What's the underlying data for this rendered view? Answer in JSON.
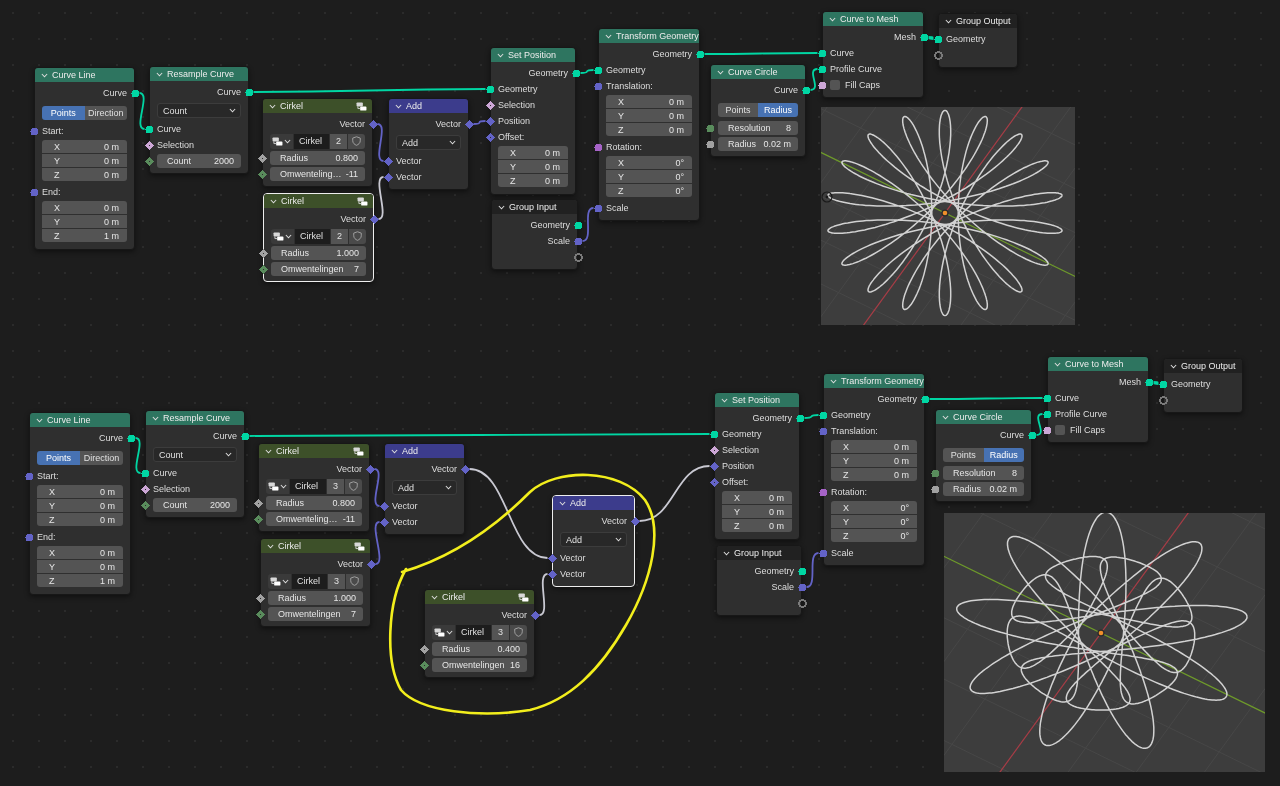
{
  "graphs": [
    {
      "nodes": [
        {
          "title": "Curve Line",
          "kind": "node",
          "color": "#2e7560",
          "selected": false,
          "rows": [
            {
              "kind": "output",
              "label": "Curve",
              "socket": {
                "kind": "circle",
                "color": "#00d6a3"
              }
            },
            {
              "kind": "toggle",
              "options": [
                {
                  "label": "Points",
                  "selected": true
                },
                {
                  "label": "Direction",
                  "selected": false
                }
              ]
            },
            {
              "kind": "input",
              "label": "Start:",
              "socket": {
                "kind": "circle",
                "color": "#6363c7"
              }
            },
            {
              "kind": "vector",
              "fields": [
                {
                  "axis": "X",
                  "value": "0 m"
                },
                {
                  "axis": "Y",
                  "value": "0 m"
                },
                {
                  "axis": "Z",
                  "value": "0 m"
                }
              ]
            },
            {
              "kind": "input",
              "label": "End:",
              "socket": {
                "kind": "circle",
                "color": "#6363c7"
              }
            },
            {
              "kind": "vector",
              "fields": [
                {
                  "axis": "X",
                  "value": "0 m"
                },
                {
                  "axis": "Y",
                  "value": "0 m"
                },
                {
                  "axis": "Z",
                  "value": "1 m"
                }
              ]
            }
          ]
        },
        {
          "title": "Resample Curve",
          "kind": "node",
          "color": "#2e7560",
          "selected": false,
          "rows": [
            {
              "kind": "output",
              "label": "Curve",
              "socket": {
                "kind": "circle",
                "color": "#00d6a3"
              }
            },
            {
              "kind": "dropdown",
              "value": "Count"
            },
            {
              "kind": "input",
              "label": "Curve",
              "socket": {
                "kind": "circle",
                "color": "#00d6a3"
              }
            },
            {
              "kind": "input",
              "label": "Selection",
              "socket": {
                "kind": "dotted",
                "color": "#cca6d6"
              }
            },
            {
              "kind": "field",
              "label": "Count",
              "value": "2000",
              "socket": {
                "kind": "dotted",
                "color": "#598c5c"
              }
            }
          ]
        },
        {
          "title": "Cirkel",
          "kind": "group",
          "color": "#3d5029",
          "selected": false,
          "rows": [
            {
              "kind": "output",
              "label": "Vector",
              "socket": {
                "kind": "diamond",
                "color": "#6363c7"
              }
            },
            {
              "kind": "datablock",
              "name": "Cirkel",
              "users": "2"
            },
            {
              "kind": "field",
              "label": "Radius",
              "value": "0.800",
              "socket": {
                "kind": "dotted",
                "color": "#a1a1a1"
              }
            },
            {
              "kind": "field",
              "label": "Omwenteling…",
              "value": "-11",
              "socket": {
                "kind": "dotted",
                "color": "#598c5c"
              }
            }
          ]
        },
        {
          "title": "Cirkel",
          "kind": "group",
          "color": "#3d5029",
          "selected": true,
          "rows": [
            {
              "kind": "output",
              "label": "Vector",
              "socket": {
                "kind": "diamond",
                "color": "#6363c7"
              }
            },
            {
              "kind": "datablock",
              "name": "Cirkel",
              "users": "2"
            },
            {
              "kind": "field",
              "label": "Radius",
              "value": "1.000",
              "socket": {
                "kind": "dotted",
                "color": "#a1a1a1"
              }
            },
            {
              "kind": "field",
              "label": "Omwentelingen",
              "value": "7",
              "socket": {
                "kind": "dotted",
                "color": "#598c5c"
              }
            }
          ]
        },
        {
          "title": "Add",
          "kind": "node",
          "color": "#3c3c8c",
          "selected": false,
          "rows": [
            {
              "kind": "output",
              "label": "Vector",
              "socket": {
                "kind": "diamond",
                "color": "#6363c7"
              }
            },
            {
              "kind": "dropdown",
              "value": "Add"
            },
            {
              "kind": "input",
              "label": "Vector",
              "socket": {
                "kind": "diamond",
                "color": "#6363c7"
              }
            },
            {
              "kind": "input",
              "label": "Vector",
              "socket": {
                "kind": "diamond",
                "color": "#6363c7"
              }
            }
          ]
        },
        {
          "title": "Set Position",
          "kind": "node",
          "color": "#2e7560",
          "selected": false,
          "rows": [
            {
              "kind": "output",
              "label": "Geometry",
              "socket": {
                "kind": "circle",
                "color": "#00d6a3"
              }
            },
            {
              "kind": "input",
              "label": "Geometry",
              "socket": {
                "kind": "circle",
                "color": "#00d6a3"
              }
            },
            {
              "kind": "input",
              "label": "Selection",
              "socket": {
                "kind": "dotted",
                "color": "#cca6d6"
              }
            },
            {
              "kind": "input",
              "label": "Position",
              "socket": {
                "kind": "diamond",
                "color": "#6363c7"
              }
            },
            {
              "kind": "input",
              "label": "Offset:",
              "socket": {
                "kind": "dotted",
                "color": "#6363c7"
              }
            },
            {
              "kind": "vector",
              "fields": [
                {
                  "axis": "X",
                  "value": "0 m"
                },
                {
                  "axis": "Y",
                  "value": "0 m"
                },
                {
                  "axis": "Z",
                  "value": "0 m"
                }
              ]
            }
          ]
        },
        {
          "title": "Group Input",
          "kind": "node",
          "color": "#212121",
          "selected": false,
          "rows": [
            {
              "kind": "output",
              "label": "Geometry",
              "socket": {
                "kind": "circle",
                "color": "#00d6a3"
              }
            },
            {
              "kind": "output",
              "label": "Scale",
              "socket": {
                "kind": "circle",
                "color": "#6363c7"
              }
            },
            {
              "kind": "output",
              "socket": {
                "kind": "ring",
                "color": "#7a7a7a"
              }
            }
          ]
        },
        {
          "title": "Transform Geometry",
          "kind": "node",
          "color": "#2e7560",
          "selected": false,
          "rows": [
            {
              "kind": "output",
              "label": "Geometry",
              "socket": {
                "kind": "circle",
                "color": "#00d6a3"
              }
            },
            {
              "kind": "input",
              "label": "Geometry",
              "socket": {
                "kind": "circle",
                "color": "#00d6a3"
              }
            },
            {
              "kind": "input",
              "label": "Translation:",
              "socket": {
                "kind": "circle",
                "color": "#6363c7"
              }
            },
            {
              "kind": "vector",
              "fields": [
                {
                  "axis": "X",
                  "value": "0 m"
                },
                {
                  "axis": "Y",
                  "value": "0 m"
                },
                {
                  "axis": "Z",
                  "value": "0 m"
                }
              ]
            },
            {
              "kind": "input",
              "label": "Rotation:",
              "socket": {
                "kind": "circle",
                "color": "#a663c7"
              }
            },
            {
              "kind": "vector",
              "fields": [
                {
                  "axis": "X",
                  "value": "0°"
                },
                {
                  "axis": "Y",
                  "value": "0°"
                },
                {
                  "axis": "Z",
                  "value": "0°"
                }
              ]
            },
            {
              "kind": "input",
              "label": "Scale",
              "socket": {
                "kind": "circle",
                "color": "#6363c7"
              }
            }
          ]
        },
        {
          "title": "Curve Circle",
          "kind": "node",
          "color": "#2e7560",
          "selected": false,
          "rows": [
            {
              "kind": "output",
              "label": "Curve",
              "socket": {
                "kind": "circle",
                "color": "#00d6a3"
              }
            },
            {
              "kind": "toggle",
              "options": [
                {
                  "label": "Points",
                  "selected": false
                },
                {
                  "label": "Radius",
                  "selected": true
                }
              ]
            },
            {
              "kind": "field",
              "label": "Resolution",
              "value": "8",
              "socket": {
                "kind": "circle",
                "color": "#598c5c"
              }
            },
            {
              "kind": "field",
              "label": "Radius",
              "value": "0.02 m",
              "socket": {
                "kind": "circle",
                "color": "#a1a1a1"
              }
            }
          ]
        },
        {
          "title": "Curve to Mesh",
          "kind": "node",
          "color": "#2e7560",
          "selected": false,
          "rows": [
            {
              "kind": "output",
              "label": "Mesh",
              "socket": {
                "kind": "circle",
                "color": "#00d6a3"
              }
            },
            {
              "kind": "input",
              "label": "Curve",
              "socket": {
                "kind": "circle",
                "color": "#00d6a3"
              }
            },
            {
              "kind": "input",
              "label": "Profile Curve",
              "socket": {
                "kind": "circle",
                "color": "#00d6a3"
              }
            },
            {
              "kind": "checkbox",
              "label": "Fill Caps",
              "checked": false,
              "socket": {
                "kind": "circle",
                "color": "#cca6d6"
              }
            }
          ]
        },
        {
          "title": "Group Output",
          "kind": "node",
          "color": "#212121",
          "selected": false,
          "rows": [
            {
              "kind": "input",
              "label": "Geometry",
              "socket": {
                "kind": "circle",
                "color": "#00d6a3"
              }
            },
            {
              "kind": "input",
              "socket": {
                "kind": "ring",
                "color": "#7a7a7a"
              }
            }
          ]
        }
      ]
    },
    {
      "nodes": [
        {
          "title": "Curve Line",
          "kind": "node",
          "color": "#2e7560",
          "selected": false,
          "rows": [
            {
              "kind": "output",
              "label": "Curve",
              "socket": {
                "kind": "circle",
                "color": "#00d6a3"
              }
            },
            {
              "kind": "toggle",
              "options": [
                {
                  "label": "Points",
                  "selected": true
                },
                {
                  "label": "Direction",
                  "selected": false
                }
              ]
            },
            {
              "kind": "input",
              "label": "Start:",
              "socket": {
                "kind": "circle",
                "color": "#6363c7"
              }
            },
            {
              "kind": "vector",
              "fields": [
                {
                  "axis": "X",
                  "value": "0 m"
                },
                {
                  "axis": "Y",
                  "value": "0 m"
                },
                {
                  "axis": "Z",
                  "value": "0 m"
                }
              ]
            },
            {
              "kind": "input",
              "label": "End:",
              "socket": {
                "kind": "circle",
                "color": "#6363c7"
              }
            },
            {
              "kind": "vector",
              "fields": [
                {
                  "axis": "X",
                  "value": "0 m"
                },
                {
                  "axis": "Y",
                  "value": "0 m"
                },
                {
                  "axis": "Z",
                  "value": "1 m"
                }
              ]
            }
          ]
        },
        {
          "title": "Resample Curve",
          "kind": "node",
          "color": "#2e7560",
          "selected": false,
          "rows": [
            {
              "kind": "output",
              "label": "Curve",
              "socket": {
                "kind": "circle",
                "color": "#00d6a3"
              }
            },
            {
              "kind": "dropdown",
              "value": "Count"
            },
            {
              "kind": "input",
              "label": "Curve",
              "socket": {
                "kind": "circle",
                "color": "#00d6a3"
              }
            },
            {
              "kind": "input",
              "label": "Selection",
              "socket": {
                "kind": "dotted",
                "color": "#cca6d6"
              }
            },
            {
              "kind": "field",
              "label": "Count",
              "value": "2000",
              "socket": {
                "kind": "dotted",
                "color": "#598c5c"
              }
            }
          ]
        },
        {
          "title": "Cirkel",
          "kind": "group",
          "color": "#3d5029",
          "selected": false,
          "rows": [
            {
              "kind": "output",
              "label": "Vector",
              "socket": {
                "kind": "diamond",
                "color": "#6363c7"
              }
            },
            {
              "kind": "datablock",
              "name": "Cirkel",
              "users": "3"
            },
            {
              "kind": "field",
              "label": "Radius",
              "value": "0.800",
              "socket": {
                "kind": "dotted",
                "color": "#a1a1a1"
              }
            },
            {
              "kind": "field",
              "label": "Omwenteling…",
              "value": "-11",
              "socket": {
                "kind": "dotted",
                "color": "#598c5c"
              }
            }
          ]
        },
        {
          "title": "Cirkel",
          "kind": "group",
          "color": "#3d5029",
          "selected": false,
          "rows": [
            {
              "kind": "output",
              "label": "Vector",
              "socket": {
                "kind": "diamond",
                "color": "#6363c7"
              }
            },
            {
              "kind": "datablock",
              "name": "Cirkel",
              "users": "3"
            },
            {
              "kind": "field",
              "label": "Radius",
              "value": "1.000",
              "socket": {
                "kind": "dotted",
                "color": "#a1a1a1"
              }
            },
            {
              "kind": "field",
              "label": "Omwentelingen",
              "value": "7",
              "socket": {
                "kind": "dotted",
                "color": "#598c5c"
              }
            }
          ]
        },
        {
          "title": "Add",
          "kind": "node",
          "color": "#3c3c8c",
          "selected": false,
          "rows": [
            {
              "kind": "output",
              "label": "Vector",
              "socket": {
                "kind": "diamond",
                "color": "#6363c7"
              }
            },
            {
              "kind": "dropdown",
              "value": "Add"
            },
            {
              "kind": "input",
              "label": "Vector",
              "socket": {
                "kind": "diamond",
                "color": "#6363c7"
              }
            },
            {
              "kind": "input",
              "label": "Vector",
              "socket": {
                "kind": "diamond",
                "color": "#6363c7"
              }
            }
          ]
        },
        {
          "title": "Add",
          "kind": "node",
          "color": "#3c3c8c",
          "selected": true,
          "rows": [
            {
              "kind": "output",
              "label": "Vector",
              "socket": {
                "kind": "diamond",
                "color": "#6363c7"
              }
            },
            {
              "kind": "dropdown",
              "value": "Add"
            },
            {
              "kind": "input",
              "label": "Vector",
              "socket": {
                "kind": "diamond",
                "color": "#6363c7"
              }
            },
            {
              "kind": "input",
              "label": "Vector",
              "socket": {
                "kind": "diamond",
                "color": "#6363c7"
              }
            }
          ]
        },
        {
          "title": "Cirkel",
          "kind": "group",
          "color": "#3d5029",
          "selected": false,
          "rows": [
            {
              "kind": "output",
              "label": "Vector",
              "socket": {
                "kind": "diamond",
                "color": "#6363c7"
              }
            },
            {
              "kind": "datablock",
              "name": "Cirkel",
              "users": "3"
            },
            {
              "kind": "field",
              "label": "Radius",
              "value": "0.400",
              "socket": {
                "kind": "dotted",
                "color": "#a1a1a1"
              }
            },
            {
              "kind": "field",
              "label": "Omwentelingen",
              "value": "16",
              "socket": {
                "kind": "dotted",
                "color": "#598c5c"
              }
            }
          ]
        },
        {
          "title": "Set Position",
          "kind": "node",
          "color": "#2e7560",
          "selected": false,
          "rows": [
            {
              "kind": "output",
              "label": "Geometry",
              "socket": {
                "kind": "circle",
                "color": "#00d6a3"
              }
            },
            {
              "kind": "input",
              "label": "Geometry",
              "socket": {
                "kind": "circle",
                "color": "#00d6a3"
              }
            },
            {
              "kind": "input",
              "label": "Selection",
              "socket": {
                "kind": "dotted",
                "color": "#cca6d6"
              }
            },
            {
              "kind": "input",
              "label": "Position",
              "socket": {
                "kind": "diamond",
                "color": "#6363c7"
              }
            },
            {
              "kind": "input",
              "label": "Offset:",
              "socket": {
                "kind": "dotted",
                "color": "#6363c7"
              }
            },
            {
              "kind": "vector",
              "fields": [
                {
                  "axis": "X",
                  "value": "0 m"
                },
                {
                  "axis": "Y",
                  "value": "0 m"
                },
                {
                  "axis": "Z",
                  "value": "0 m"
                }
              ]
            }
          ]
        },
        {
          "title": "Group Input",
          "kind": "node",
          "color": "#212121",
          "selected": false,
          "rows": [
            {
              "kind": "output",
              "label": "Geometry",
              "socket": {
                "kind": "circle",
                "color": "#00d6a3"
              }
            },
            {
              "kind": "output",
              "label": "Scale",
              "socket": {
                "kind": "circle",
                "color": "#6363c7"
              }
            },
            {
              "kind": "output",
              "socket": {
                "kind": "ring",
                "color": "#7a7a7a"
              }
            }
          ]
        },
        {
          "title": "Transform Geometry",
          "kind": "node",
          "color": "#2e7560",
          "selected": false,
          "rows": [
            {
              "kind": "output",
              "label": "Geometry",
              "socket": {
                "kind": "circle",
                "color": "#00d6a3"
              }
            },
            {
              "kind": "input",
              "label": "Geometry",
              "socket": {
                "kind": "circle",
                "color": "#00d6a3"
              }
            },
            {
              "kind": "input",
              "label": "Translation:",
              "socket": {
                "kind": "circle",
                "color": "#6363c7"
              }
            },
            {
              "kind": "vector",
              "fields": [
                {
                  "axis": "X",
                  "value": "0 m"
                },
                {
                  "axis": "Y",
                  "value": "0 m"
                },
                {
                  "axis": "Z",
                  "value": "0 m"
                }
              ]
            },
            {
              "kind": "input",
              "label": "Rotation:",
              "socket": {
                "kind": "circle",
                "color": "#a663c7"
              }
            },
            {
              "kind": "vector",
              "fields": [
                {
                  "axis": "X",
                  "value": "0°"
                },
                {
                  "axis": "Y",
                  "value": "0°"
                },
                {
                  "axis": "Z",
                  "value": "0°"
                }
              ]
            },
            {
              "kind": "input",
              "label": "Scale",
              "socket": {
                "kind": "circle",
                "color": "#6363c7"
              }
            }
          ]
        },
        {
          "title": "Curve Circle",
          "kind": "node",
          "color": "#2e7560",
          "selected": false,
          "rows": [
            {
              "kind": "output",
              "label": "Curve",
              "socket": {
                "kind": "circle",
                "color": "#00d6a3"
              }
            },
            {
              "kind": "toggle",
              "options": [
                {
                  "label": "Points",
                  "selected": false
                },
                {
                  "label": "Radius",
                  "selected": true
                }
              ]
            },
            {
              "kind": "field",
              "label": "Resolution",
              "value": "8",
              "socket": {
                "kind": "circle",
                "color": "#598c5c"
              }
            },
            {
              "kind": "field",
              "label": "Radius",
              "value": "0.02 m",
              "socket": {
                "kind": "circle",
                "color": "#a1a1a1"
              }
            }
          ]
        },
        {
          "title": "Curve to Mesh",
          "kind": "node",
          "color": "#2e7560",
          "selected": false,
          "rows": [
            {
              "kind": "output",
              "label": "Mesh",
              "socket": {
                "kind": "circle",
                "color": "#00d6a3"
              }
            },
            {
              "kind": "input",
              "label": "Curve",
              "socket": {
                "kind": "circle",
                "color": "#00d6a3"
              }
            },
            {
              "kind": "input",
              "label": "Profile Curve",
              "socket": {
                "kind": "circle",
                "color": "#00d6a3"
              }
            },
            {
              "kind": "checkbox",
              "label": "Fill Caps",
              "checked": false,
              "socket": {
                "kind": "circle",
                "color": "#cca6d6"
              }
            }
          ]
        },
        {
          "title": "Group Output",
          "kind": "node",
          "color": "#212121",
          "selected": false,
          "rows": [
            {
              "kind": "input",
              "label": "Geometry",
              "socket": {
                "kind": "circle",
                "color": "#00d6a3"
              }
            },
            {
              "kind": "input",
              "socket": {
                "kind": "ring",
                "color": "#7a7a7a"
              }
            }
          ]
        }
      ]
    }
  ]
}
